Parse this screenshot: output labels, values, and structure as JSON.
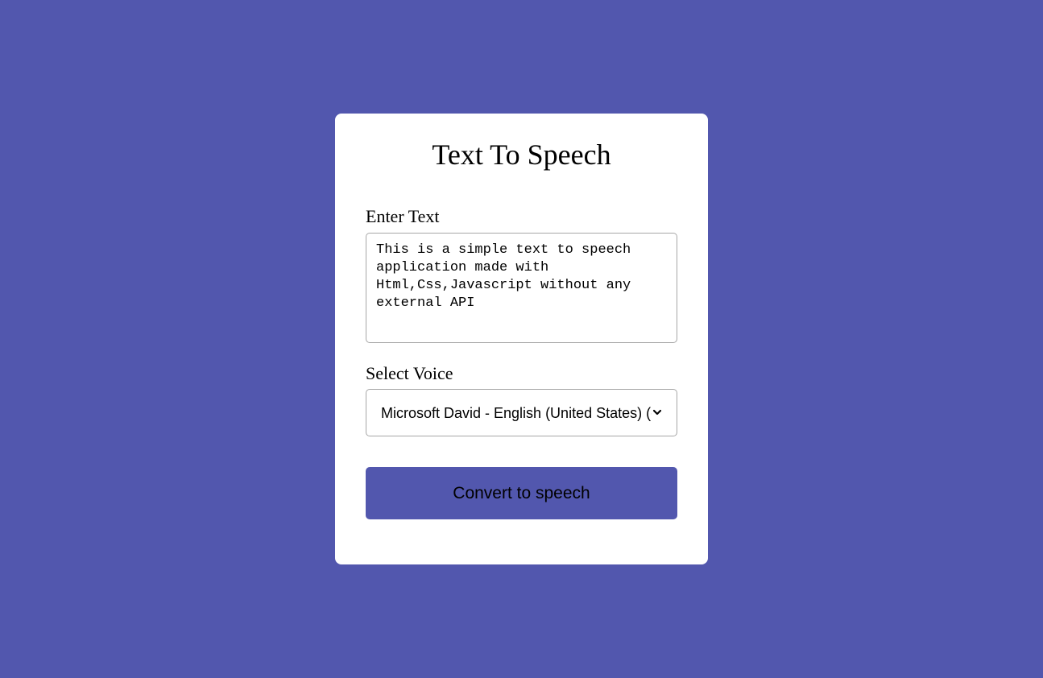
{
  "page": {
    "background_color": "#5257ae",
    "card_color": "#ffffff"
  },
  "app": {
    "title": "Text To Speech"
  },
  "text_input": {
    "label": "Enter Text",
    "value": "This is a simple text to speech application made with Html,Css,Javascript without any external API"
  },
  "voice_select": {
    "label": "Select Voice",
    "selected_value": "Microsoft David - English (United States) (en-US)",
    "icon": "chevron-down-icon"
  },
  "convert_button": {
    "label": "Convert to speech",
    "color": "#5257ae"
  }
}
